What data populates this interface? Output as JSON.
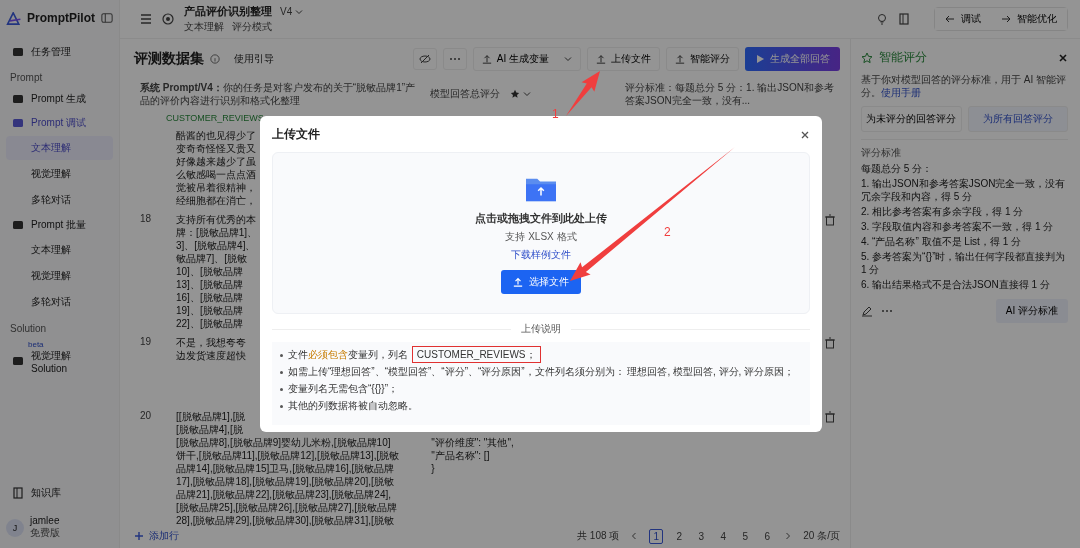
{
  "sidebar": {
    "logo": "PromptPilot",
    "items": [
      {
        "label": "任务管理",
        "kind": "item",
        "selected": false
      },
      {
        "label": "Prompt",
        "kind": "section"
      },
      {
        "label": "Prompt 生成",
        "kind": "item",
        "selected": false
      },
      {
        "label": "Prompt 调试",
        "kind": "item",
        "selected": true,
        "children": [
          {
            "label": "文本理解",
            "selected": true
          },
          {
            "label": "视觉理解",
            "selected": false
          },
          {
            "label": "多轮对话",
            "selected": false
          }
        ]
      },
      {
        "label": "Prompt 批量",
        "kind": "item",
        "selected": false,
        "children": [
          {
            "label": "文本理解",
            "selected": false
          },
          {
            "label": "视觉理解",
            "selected": false
          },
          {
            "label": "多轮对话",
            "selected": false
          }
        ]
      },
      {
        "label": "Solution",
        "kind": "section"
      },
      {
        "label": "视觉理解 Solution",
        "kind": "item",
        "selected": false,
        "badge": "beta"
      }
    ],
    "knowledge": "知识库",
    "user": {
      "avatar": "J",
      "name": "jamlee",
      "plan": "免费版"
    }
  },
  "topbar": {
    "title": "产品评价识别整理",
    "version": "V4",
    "tags": [
      "文本理解",
      "评分模式"
    ],
    "nav_buttons": [
      "调试",
      "智能优化"
    ]
  },
  "dataset": {
    "title": "评测数据集",
    "guide": "使用引导",
    "toolbar": [
      "AI 生成变量",
      "上传文件",
      "智能评分"
    ],
    "primary": "生成全部回答",
    "system_prompt_label": "系统 Prompt/V4：",
    "system_prompt": "你的任务是对客户发布的关于“脱敏品牌1”产品的评价内容进行识别和格式化整理",
    "score_label": "模型回答总评分",
    "criteria_summary": "评分标准：每题总分 5 分：1. 输出JSON和参考答案JSON完全一致，没有...",
    "column": "CUSTOMER_REVIEWS",
    "rows": [
      {
        "number": "",
        "lines": [
          "酷酱的也见得少了",
          "变奇奇怪怪又贵又",
          "好像越来越少了虽",
          "么敏感喝一点点酒",
          "觉被吊着很精神，",
          "经细胞都在消亡，"
        ],
        "answer": []
      },
      {
        "number": "18",
        "lines": [
          "支持所有优秀的本",
          "牌：[脱敏品牌1]、",
          "3]、[脱敏品牌4]、",
          "敏品牌7]、[脱敏",
          "10]、[脱敏品牌",
          "13]、[脱敏品牌",
          "16]、[脱敏品牌",
          "19]、[脱敏品牌",
          "22]、[脱敏品牌"
        ],
        "answer": []
      },
      {
        "number": "19",
        "lines": [
          "不是，我想夸夸",
          "边发货速度超快"
        ],
        "answer": []
      },
      {
        "number": "20",
        "lines": [
          "[[脱敏品牌1],[脱",
          "[脱敏品牌4],[脱",
          "[脱敏品牌8],[脱敏品牌9]婴幼儿米粉,[脱敏品牌10]",
          "饼干,[脱敏品牌11],[脱敏品牌12],[脱敏品牌13],[脱敏",
          "品牌14],[脱敏品牌15]卫马,[脱敏品牌16],[脱敏品牌",
          "17],[脱敏品牌18],[脱敏品牌19],[脱敏品牌20],[脱敏",
          "品牌21],[脱敏品牌22],[脱敏品牌23],[脱敏品牌24],",
          "[脱敏品牌25],[脱敏品牌26],[脱敏品牌27],[脱敏品牌",
          "28],[脱敏品牌29],[脱敏品牌30],[脱敏品牌31],[脱敏"
        ],
        "answer": [
          "\"评价维度\": \"其他\",",
          "\"产品名称\": []",
          "}"
        ]
      }
    ],
    "add_row": "添加行",
    "pagination": {
      "total": "共 108 项",
      "pages": [
        {
          "label": "1",
          "selected": true
        },
        {
          "label": "2",
          "selected": false
        },
        {
          "label": "3",
          "selected": false
        },
        {
          "label": "4",
          "selected": false
        },
        {
          "label": "5",
          "selected": false
        },
        {
          "label": "6",
          "selected": false
        }
      ],
      "page_size": "20 条/页"
    }
  },
  "scoring_panel": {
    "title": "智能评分",
    "description": "基于你对模型回答的评分标准，用于 AI 智能评分。",
    "manual_link": "使用手册",
    "buttons": [
      {
        "label": "为未评分的回答评分",
        "selected": false
      },
      {
        "label": "为所有回答评分",
        "selected": true
      }
    ],
    "criteria_label": "评分标准",
    "criteria": [
      "每题总分 5 分：",
      "1. 输出JSON和参考答案JSON完全一致，没有冗余字段和内容，得 5 分",
      "2. 相比参考答案有多余字段，得 1 分",
      "3. 字段取值内容和参考答案不一致，得 1 分",
      "4. “产品名称” 取值不是 List，得 1 分",
      "5. 参考答案为“{}”时，输出任何字段都直接判为 1 分",
      "6. 输出结果格式不是合法JSON直接得 1 分"
    ],
    "ai_button": "AI 评分标准"
  },
  "modal": {
    "title": "上传文件",
    "drop_text": "点击或拖拽文件到此处上传",
    "formats": "支持 XLSX 格式",
    "sample_link": "下载样例文件",
    "choose_button": "选择文件",
    "notes_title": "上传说明",
    "notes": [
      [
        {
          "text": "文件"
        },
        {
          "text": "必须包含",
          "kind": "highlight"
        },
        {
          "text": "变量列，列名 "
        },
        {
          "text": "CUSTOMER_REVIEWS；",
          "kind": "boxed"
        }
      ],
      [
        {
          "text": "如需上传“理想回答”、“模型回答”、“评分”、“评分原因”，文件列名须分别为： 理想回答, 模型回答, 评分, 评分原因；"
        }
      ],
      [
        {
          "text": "变量列名无需包含“{{}}”；"
        }
      ],
      [
        {
          "text": "其他的列数据将被自动忽略。"
        }
      ]
    ]
  },
  "annotations": [
    {
      "label": "1"
    },
    {
      "label": "2"
    }
  ]
}
